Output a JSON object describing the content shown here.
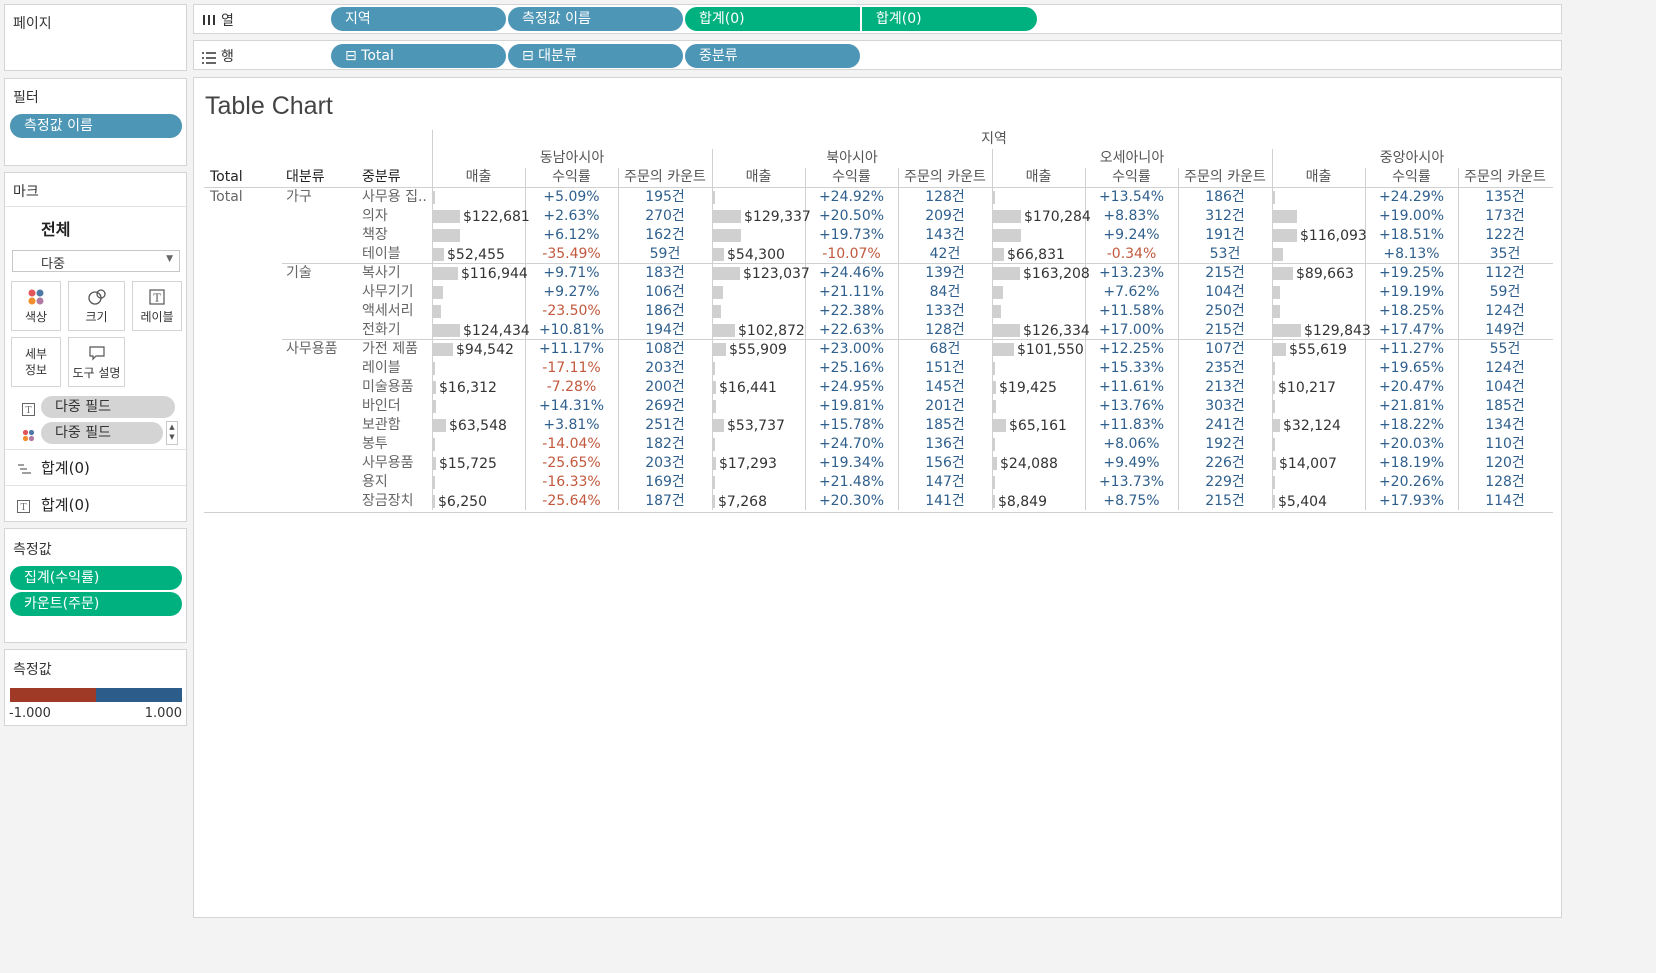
{
  "sidebar": {
    "pages_title": "페이지",
    "filters_title": "필터",
    "filter_pill": "측정값 이름",
    "marks_title": "마크",
    "marks_all": "전체",
    "mark_type": "다중",
    "mark_buttons": {
      "color": "색상",
      "size": "크기",
      "label": "레이블",
      "detail": "세부\n정보",
      "tooltip": "도구 설명"
    },
    "mark_fields": [
      "다중 필드",
      "다중 필드"
    ],
    "sum_rows": [
      "합계(0)",
      "합계(0)"
    ],
    "measures_title": "측정값",
    "measure_pills": [
      "집계(수익률)",
      "카운트(주문)"
    ],
    "legend_title": "측정값",
    "legend_min": "-1.000",
    "legend_max": "1.000",
    "colors": {
      "neg": "#9e3a26",
      "pos": "#2c5d8a"
    }
  },
  "shelves": {
    "columns_label": "열",
    "rows_label": "행",
    "column_pills": [
      "지역",
      "측정값 이름",
      "합계(0)",
      "합계(0)"
    ],
    "row_pills": [
      "⊟ Total",
      "⊟ 대분류",
      "중분류"
    ]
  },
  "view": {
    "title": "Table Chart",
    "region_header": "지역",
    "row_headers": [
      "Total",
      "대분류",
      "중분류"
    ],
    "regions": [
      "동남아시아",
      "북아시아",
      "오세아니아",
      "중앙아시아"
    ],
    "measures": [
      "매출",
      "수익률",
      "주문의 카운트"
    ],
    "total_label": "Total",
    "groups": [
      {
        "name": "가구",
        "rows": [
          {
            "sub": "사무용 집..",
            "cells": [
              [
                null,
                "+5.09%",
                "195건",
                0.03
              ],
              [
                null,
                "+24.92%",
                "128건",
                0.03
              ],
              [
                null,
                "+13.54%",
                "186건",
                0.03
              ],
              [
                null,
                "+24.29%",
                "135건",
                0.03
              ]
            ]
          },
          {
            "sub": "의자",
            "cells": [
              [
                "$122,681",
                "+2.63%",
                "270건",
                0.95
              ],
              [
                "$129,337",
                "+20.50%",
                "209건",
                1.0
              ],
              [
                "$170,284",
                "+8.83%",
                "312건",
                1.0
              ],
              [
                null,
                "+19.00%",
                "173건",
                0.85
              ]
            ]
          },
          {
            "sub": "책장",
            "cells": [
              [
                null,
                "+6.12%",
                "162건",
                0.95
              ],
              [
                null,
                "+19.73%",
                "143건",
                1.0
              ],
              [
                null,
                "+9.24%",
                "191건",
                1.0
              ],
              [
                "$116,093",
                "+18.51%",
                "122건",
                0.85
              ]
            ]
          },
          {
            "sub": "테이블",
            "cells": [
              [
                "$52,455",
                "-35.49%",
                "59건",
                0.4
              ],
              [
                "$54,300",
                "-10.07%",
                "42건",
                0.4
              ],
              [
                "$66,831",
                "-0.34%",
                "53건",
                0.4
              ],
              [
                null,
                "+8.13%",
                "35건",
                0.35
              ]
            ]
          }
        ]
      },
      {
        "name": "기술",
        "rows": [
          {
            "sub": "복사기",
            "cells": [
              [
                "$116,944",
                "+9.71%",
                "183건",
                0.9
              ],
              [
                "$123,037",
                "+24.46%",
                "139건",
                0.95
              ],
              [
                "$163,208",
                "+13.23%",
                "215건",
                0.95
              ],
              [
                "$89,663",
                "+19.25%",
                "112건",
                0.7
              ]
            ]
          },
          {
            "sub": "사무기기",
            "cells": [
              [
                null,
                "+9.27%",
                "106건",
                0.35
              ],
              [
                null,
                "+21.11%",
                "84건",
                0.35
              ],
              [
                null,
                "+7.62%",
                "104건",
                0.35
              ],
              [
                null,
                "+19.19%",
                "59건",
                0.25
              ]
            ]
          },
          {
            "sub": "액세서리",
            "cells": [
              [
                null,
                "-23.50%",
                "186건",
                0.3
              ],
              [
                null,
                "+22.38%",
                "133건",
                0.3
              ],
              [
                null,
                "+11.58%",
                "250건",
                0.3
              ],
              [
                null,
                "+18.25%",
                "124건",
                0.25
              ]
            ]
          },
          {
            "sub": "전화기",
            "cells": [
              [
                "$124,434",
                "+10.81%",
                "194건",
                0.95
              ],
              [
                "$102,872",
                "+22.63%",
                "128건",
                0.8
              ],
              [
                "$126,334",
                "+17.00%",
                "215건",
                0.95
              ],
              [
                "$129,843",
                "+17.47%",
                "149건",
                1.0
              ]
            ]
          }
        ]
      },
      {
        "name": "사무용품",
        "rows": [
          {
            "sub": "가전 제품",
            "cells": [
              [
                "$94,542",
                "+11.17%",
                "108건",
                0.7
              ],
              [
                "$55,909",
                "+23.00%",
                "68건",
                0.45
              ],
              [
                "$101,550",
                "+12.25%",
                "107건",
                0.75
              ],
              [
                "$55,619",
                "+11.27%",
                "55건",
                0.45
              ]
            ]
          },
          {
            "sub": "레이블",
            "cells": [
              [
                null,
                "-17.11%",
                "203건",
                0.02
              ],
              [
                null,
                "+25.16%",
                "151건",
                0.02
              ],
              [
                null,
                "+15.33%",
                "235건",
                0.02
              ],
              [
                null,
                "+19.65%",
                "124건",
                0.02
              ]
            ]
          },
          {
            "sub": "미술용품",
            "cells": [
              [
                "$16,312",
                "-7.28%",
                "200건",
                0.12
              ],
              [
                "$16,441",
                "+24.95%",
                "145건",
                0.12
              ],
              [
                "$19,425",
                "+11.61%",
                "213건",
                0.12
              ],
              [
                "$10,217",
                "+20.47%",
                "104건",
                0.08
              ]
            ]
          },
          {
            "sub": "바인더",
            "cells": [
              [
                null,
                "+14.31%",
                "269건",
                0.12
              ],
              [
                null,
                "+19.81%",
                "201건",
                0.12
              ],
              [
                null,
                "+13.76%",
                "303건",
                0.12
              ],
              [
                null,
                "+21.81%",
                "185건",
                0.08
              ]
            ]
          },
          {
            "sub": "보관함",
            "cells": [
              [
                "$63,548",
                "+3.81%",
                "251건",
                0.45
              ],
              [
                "$53,737",
                "+15.78%",
                "185건",
                0.4
              ],
              [
                "$65,161",
                "+11.83%",
                "241건",
                0.45
              ],
              [
                "$32,124",
                "+18.22%",
                "134건",
                0.25
              ]
            ]
          },
          {
            "sub": "봉투",
            "cells": [
              [
                null,
                "-14.04%",
                "182건",
                0.04
              ],
              [
                null,
                "+24.70%",
                "136건",
                0.04
              ],
              [
                null,
                "+8.06%",
                "192건",
                0.04
              ],
              [
                null,
                "+20.03%",
                "110건",
                0.04
              ]
            ]
          },
          {
            "sub": "사무용품",
            "cells": [
              [
                "$15,725",
                "-25.65%",
                "203건",
                0.12
              ],
              [
                "$17,293",
                "+19.34%",
                "156건",
                0.12
              ],
              [
                "$24,088",
                "+9.49%",
                "226건",
                0.15
              ],
              [
                "$14,007",
                "+18.19%",
                "120건",
                0.1
              ]
            ]
          },
          {
            "sub": "용지",
            "cells": [
              [
                null,
                "-16.33%",
                "169건",
                0.04
              ],
              [
                null,
                "+21.48%",
                "147건",
                0.04
              ],
              [
                null,
                "+13.73%",
                "229건",
                0.04
              ],
              [
                null,
                "+20.26%",
                "128건",
                0.04
              ]
            ]
          },
          {
            "sub": "장금장치",
            "cells": [
              [
                "$6,250",
                "-25.64%",
                "187건",
                0.02
              ],
              [
                "$7,268",
                "+20.30%",
                "141건",
                0.02
              ],
              [
                "$8,849",
                "+8.75%",
                "215건",
                0.02
              ],
              [
                "$5,404",
                "+17.93%",
                "114건",
                0.02
              ]
            ]
          }
        ]
      }
    ]
  }
}
